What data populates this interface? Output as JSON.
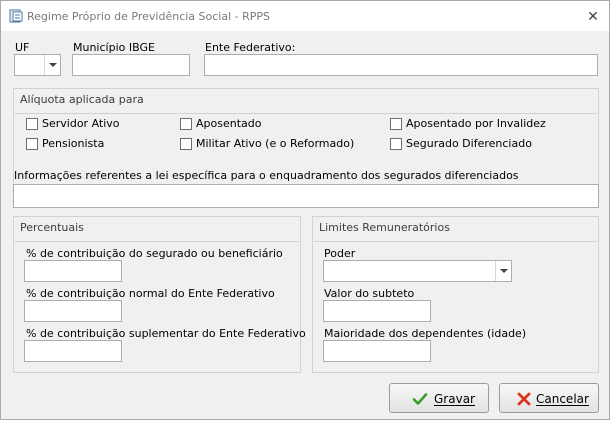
{
  "window": {
    "title": "Regime Próprio de Previdência Social  - RPPS",
    "close_glyph": "✕"
  },
  "header_fields": {
    "uf_label": "UF",
    "uf_value": "",
    "municipio_label": "Município IBGE",
    "municipio_value": "",
    "ente_label": "Ente Federativo:",
    "ente_value": ""
  },
  "aliquota": {
    "title": "Alíquota aplicada para",
    "options": [
      {
        "label": "Servidor Ativo",
        "checked": false
      },
      {
        "label": "Aposentado",
        "checked": false
      },
      {
        "label": "Aposentado por Invalidez",
        "checked": false
      },
      {
        "label": "Pensionista",
        "checked": false
      },
      {
        "label": "Militar Ativo (e o Reformado)",
        "checked": false
      },
      {
        "label": "Segurado Diferenciado",
        "checked": false
      }
    ]
  },
  "informacoes": {
    "label": "Informações referentes a lei específica para o enquadramento dos segurados diferenciados",
    "value": ""
  },
  "percentuais": {
    "title": "Percentuais",
    "segurado_label": "% de contribuição do segurado ou beneficiário",
    "segurado_value": "",
    "normal_label": "% de contribuição normal do Ente Federativo",
    "normal_value": "",
    "suplementar_label": "% de contribuição suplementar do Ente Federativo",
    "suplementar_value": ""
  },
  "limites": {
    "title": "Limites Remuneratórios",
    "poder_label": "Poder",
    "poder_value": "",
    "subteto_label": "Valor do subteto",
    "subteto_value": "",
    "maioridade_label": "Maioridade dos dependentes (idade)",
    "maioridade_value": ""
  },
  "buttons": {
    "gravar_label": "Gravar",
    "cancelar_label": "Cancelar"
  },
  "colors": {
    "check_green": "#3c9a2a",
    "cancel_red": "#d9361e"
  }
}
